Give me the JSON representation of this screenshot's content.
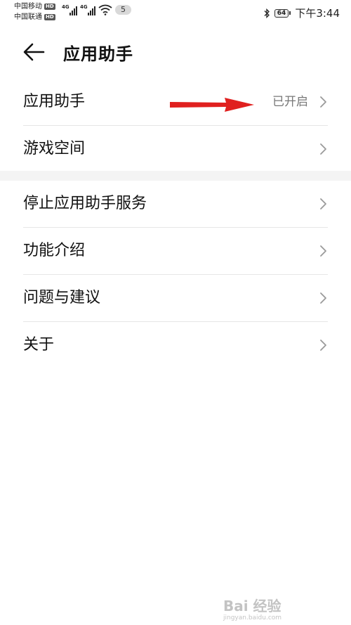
{
  "status_bar": {
    "carrier_1": "中国移动",
    "carrier_2": "中国联通",
    "hd_label": "HD",
    "network_1": "4G",
    "network_2": "4G",
    "notification_count": "5",
    "battery_level": "64",
    "time": "下午3:44"
  },
  "header": {
    "title": "应用助手"
  },
  "group_1": {
    "items": [
      {
        "label": "应用助手",
        "value": "已开启"
      },
      {
        "label": "游戏空间"
      }
    ]
  },
  "group_2": {
    "items": [
      {
        "label": "停止应用助手服务"
      },
      {
        "label": "功能介绍"
      },
      {
        "label": "问题与建议"
      },
      {
        "label": "关于"
      }
    ]
  },
  "colors": {
    "annotation_arrow": "#e0201f",
    "text_primary": "#111111",
    "text_secondary": "#777777",
    "divider": "#e6e6e6"
  },
  "watermark": {
    "text": "Bai 经验",
    "sub": "jingyan.baidu.com"
  }
}
